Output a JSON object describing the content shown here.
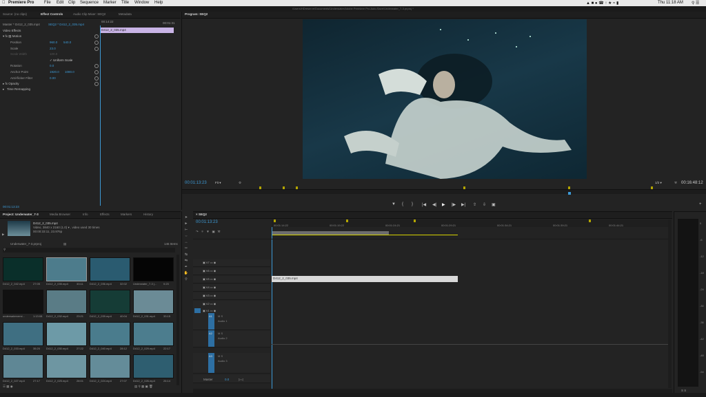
{
  "menubar": {
    "app": "Premiere Pro",
    "items": [
      "File",
      "Edit",
      "Clip",
      "Sequence",
      "Marker",
      "Title",
      "Window",
      "Help"
    ],
    "clock": "Thu 11:18 AM"
  },
  "window": {
    "title": "/Users/HDreserve/Documents/Underwater/Adobe Premiere Pro Auto-Save/Underwater_7-3.prproj *"
  },
  "source_panel": {
    "tabs": [
      "Source: (no clips)",
      "Effect Controls",
      "Audio Clip Mixer: SEQ2",
      "Metadata"
    ],
    "active_tab": "Effect Controls",
    "clip_path": "Master * D412_2_035.mp4",
    "seq_clip": "SEQ2 * D412_2_035.mp4",
    "ruler_start": "00:14:22",
    "ruler_end": "00:01:31",
    "clip_name": "D412_2_035.mp4",
    "section": "Video Effects",
    "motion": "Motion",
    "position": {
      "label": "Position",
      "x": "960.0",
      "y": "540.0"
    },
    "scale": {
      "label": "Scale",
      "value": "23.0"
    },
    "scale_width": {
      "label": "Scale Width",
      "value": "100.0"
    },
    "uniform_scale": "Uniform Scale",
    "rotation": {
      "label": "Rotation",
      "value": "0.0"
    },
    "anchor": {
      "label": "Anchor Point",
      "x": "1920.0",
      "y": "1080.0"
    },
    "antiflicker": {
      "label": "Anti-flicker Filter",
      "value": "0.00"
    },
    "opacity": "Opacity",
    "time_remapping": "Time Remapping",
    "timecode": "00:01:13:23"
  },
  "program": {
    "tab": "Program: SEQ2",
    "timecode": "00:01:13:23",
    "fit": "Fit",
    "quality": "1/2",
    "duration": "00:16:48:12"
  },
  "project": {
    "tabs": [
      "Project: Underwater_7-3",
      "Media Browser",
      "Info",
      "Effects",
      "Markers",
      "History"
    ],
    "active_tab": "Project: Underwater_7-3",
    "selected_name": "D412_2_035.mp4",
    "selected_info1": "Video, 3840 x 2160 (1.0) ▾ , video used 30 times",
    "selected_info2": "00:00:33:11, 23.976p",
    "bin": "Underwater_7-3.prproj",
    "count": "146 Items",
    "clips": [
      {
        "name": "D412_2_042.mp4",
        "dur": "27:05"
      },
      {
        "name": "D412_2_035.mp4",
        "dur": "33:11"
      },
      {
        "name": "D412_2_036.mp4",
        "dur": "32:02"
      },
      {
        "name": "Underwater_7-3 (...",
        "dur": "0:23"
      },
      {
        "name": "underwaterversi...",
        "dur": "1:13:08"
      },
      {
        "name": "D412_2_032.mp4",
        "dur": "23:21"
      },
      {
        "name": "D412_2_039.mp4",
        "dur": "40:04"
      },
      {
        "name": "D412_2_031.mp4",
        "dur": "33:15"
      },
      {
        "name": "D412_2_033.mp4",
        "dur": "35:20"
      },
      {
        "name": "D412_2_030.mp4",
        "dur": "27:22"
      },
      {
        "name": "D412_2_040.mp4",
        "dur": "28:12"
      },
      {
        "name": "D412_2_029.mp4",
        "dur": "22:17"
      },
      {
        "name": "D412_2_027.mp4",
        "dur": "27:17"
      },
      {
        "name": "D412_2_025.mp4",
        "dur": "28:01"
      },
      {
        "name": "D412_2_024.mp4",
        "dur": "27:07"
      },
      {
        "name": "D412_2_026.mp4",
        "dur": "26:14"
      }
    ]
  },
  "timeline": {
    "tab": "SEQ2",
    "timecode": "00:01:13:23",
    "ruler": [
      "00:01:14:22",
      "00:01:19:22",
      "00:01:24:21",
      "00:01:29:21",
      "00:01:34:21",
      "00:01:39:21",
      "00:01:44:21"
    ],
    "video_tracks": [
      "V7",
      "V6",
      "V5",
      "V4",
      "V3",
      "V2",
      "V1"
    ],
    "audio_tracks": [
      {
        "id": "A1",
        "name": "Audio 1"
      },
      {
        "id": "A2",
        "name": "Audio 2"
      },
      {
        "id": "A3",
        "name": "Audio 3"
      }
    ],
    "clip": "D412_2_035.mp4",
    "master": "Master",
    "master_value": "0.0"
  },
  "audio_meter": {
    "scale": [
      "0",
      "-6",
      "-12",
      "-18",
      "-24",
      "-30",
      "-36",
      "-42",
      "-48",
      "-54"
    ],
    "bottom": "S S"
  }
}
